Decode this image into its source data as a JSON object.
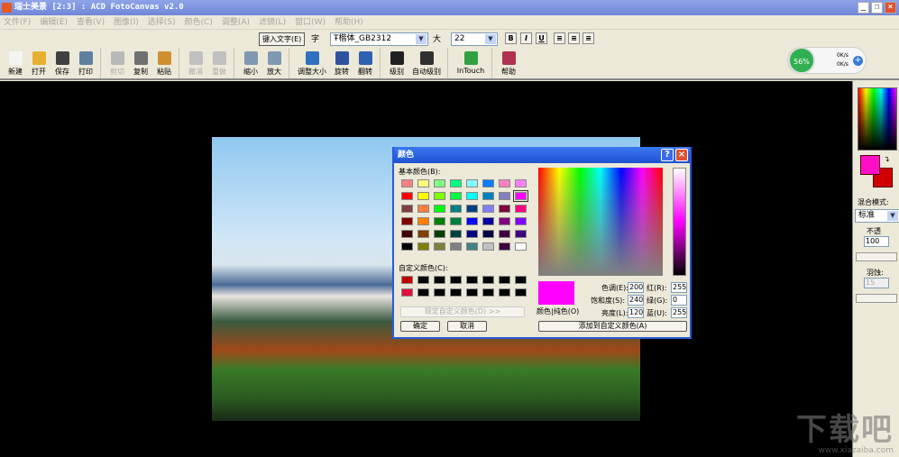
{
  "window": {
    "title": "瑞士美景 [2:3] : ACD FotoCanvas v2.0",
    "buttons": [
      "_",
      "❐",
      "×"
    ]
  },
  "menu": [
    "文件(F)",
    "编辑(E)",
    "查看(V)",
    "图像(I)",
    "选择(S)",
    "颜色(C)",
    "调整(A)",
    "滤镜(L)",
    "窗口(W)",
    "帮助(H)"
  ],
  "textbar": {
    "input_text_button": "键入文字(E)",
    "font_label": "字",
    "font_value": "Ŧ楷体_GB2312",
    "size_label": "大",
    "size_value": "22",
    "format": [
      "B",
      "I",
      "U"
    ],
    "align": [
      "≡",
      "≡",
      "≡"
    ]
  },
  "toolbar": [
    {
      "label": "新建",
      "icon": "new-file-icon",
      "color": "#f4f4f4",
      "disabled": false
    },
    {
      "label": "打开",
      "icon": "open-folder-icon",
      "color": "#e8b030",
      "disabled": false
    },
    {
      "label": "保存",
      "icon": "save-icon",
      "color": "#404040",
      "disabled": false
    },
    {
      "label": "打印",
      "icon": "print-icon",
      "color": "#6080a0",
      "disabled": false,
      "sep": true
    },
    {
      "label": "剪切",
      "icon": "cut-icon",
      "color": "#b8b8b8",
      "disabled": true
    },
    {
      "label": "复制",
      "icon": "copy-icon",
      "color": "#707070",
      "disabled": false
    },
    {
      "label": "粘贴",
      "icon": "paste-icon",
      "color": "#d09030",
      "disabled": false,
      "sep": true
    },
    {
      "label": "撤消",
      "icon": "undo-icon",
      "color": "#c0c0c0",
      "disabled": true
    },
    {
      "label": "重做",
      "icon": "redo-icon",
      "color": "#c0c0c0",
      "disabled": true,
      "sep": true
    },
    {
      "label": "缩小",
      "icon": "zoom-out-icon",
      "color": "#8098b0",
      "disabled": false
    },
    {
      "label": "放大",
      "icon": "zoom-in-icon",
      "color": "#8098b0",
      "disabled": false,
      "sep": true
    },
    {
      "label": "调整大小",
      "icon": "resize-icon",
      "color": "#3070c0",
      "disabled": false
    },
    {
      "label": "旋转",
      "icon": "rotate-icon",
      "color": "#3050a0",
      "disabled": false
    },
    {
      "label": "翻转",
      "icon": "flip-icon",
      "color": "#3060b0",
      "disabled": false,
      "sep": true
    },
    {
      "label": "级别",
      "icon": "levels-icon",
      "color": "#202020",
      "disabled": false
    },
    {
      "label": "自动级别",
      "icon": "auto-levels-icon",
      "color": "#303030",
      "disabled": false,
      "sep": true
    },
    {
      "label": "InTouch",
      "icon": "intouch-icon",
      "color": "#30a040",
      "disabled": false,
      "sep": true
    },
    {
      "label": "帮助",
      "icon": "help-book-icon",
      "color": "#b03050",
      "disabled": false
    }
  ],
  "netwidget": {
    "percent": "56%",
    "up": "0K/s",
    "down": "0K/s"
  },
  "dialog": {
    "title": "颜色",
    "help": "?",
    "close": "×",
    "basic_label": "基本颜色(B):",
    "basic_colors": [
      [
        "#FF8080",
        "#FFFF80",
        "#80FF80",
        "#00FF80",
        "#80FFFF",
        "#0080FF",
        "#FF80C0",
        "#FF80FF"
      ],
      [
        "#FF0000",
        "#FFFF00",
        "#80FF00",
        "#00FF40",
        "#00FFFF",
        "#0080C0",
        "#8080C0",
        "#FF00FF"
      ],
      [
        "#804040",
        "#FF8040",
        "#00FF00",
        "#008080",
        "#004080",
        "#8080FF",
        "#800040",
        "#FF0080"
      ],
      [
        "#800000",
        "#FF8000",
        "#008000",
        "#008040",
        "#0000FF",
        "#0000A0",
        "#800080",
        "#8000FF"
      ],
      [
        "#400000",
        "#804000",
        "#004000",
        "#004040",
        "#000080",
        "#000040",
        "#400040",
        "#400080"
      ],
      [
        "#000000",
        "#808000",
        "#808040",
        "#808080",
        "#408080",
        "#C0C0C0",
        "#400040",
        "#FFFFFF"
      ]
    ],
    "selected_basic": "#FF00FF",
    "custom_label": "自定义颜色(C):",
    "custom_colors": [
      [
        "#C00000",
        "#000000",
        "#000000",
        "#000000",
        "#000000",
        "#000000",
        "#000000",
        "#000000"
      ],
      [
        "#E0103F",
        "#000000",
        "#000000",
        "#000000",
        "#000000",
        "#000000",
        "#000000",
        "#000000"
      ]
    ],
    "define_custom": "规定自定义颜色(D) >>",
    "ok": "确定",
    "cancel": "取消",
    "color_solid": "颜色|纯色(O)",
    "hue_label": "色调(E):",
    "hue": "200",
    "sat_label": "饱和度(S):",
    "sat": "240",
    "lum_label": "亮度(L):",
    "lum": "120",
    "red_label": "红(R):",
    "red": "255",
    "green_label": "绿(G):",
    "green": "0",
    "blue_label": "蓝(U):",
    "blue": "255",
    "add_custom": "添加到自定义颜色(A)",
    "current_color": "#FF00FF"
  },
  "rpanel": {
    "fg": "#FF10C8",
    "bg": "#D00000",
    "blend_label": "混合模式:",
    "blend_value": "标准",
    "opacity_label": "不透",
    "opacity": "100",
    "feather_label": "羽蚀:",
    "feather": "15"
  },
  "watermark": {
    "logo": "下载吧",
    "url": "www.xiazaiba.com"
  }
}
